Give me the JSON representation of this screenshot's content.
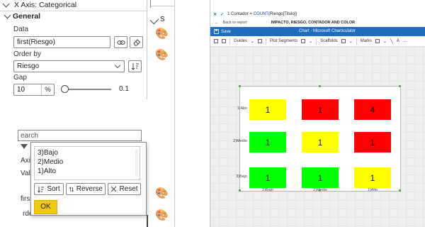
{
  "props": {
    "section_title": "X Axis: Categorical",
    "sub_title": "General",
    "data_label": "Data",
    "data_value": "first(Riesgo)",
    "order_label": "Order by",
    "order_value": "Riesgo",
    "gap_label": "Gap",
    "gap_value": "10",
    "gap_unit": "%",
    "gap_slider_value": "0.1"
  },
  "filter": {
    "search_placeholder": "earch",
    "frag_axis": "Axi",
    "frag_value": "Valu",
    "frag_first": "firs",
    "frag_order": "rde"
  },
  "sort_popup": {
    "items": [
      "3)Bajo",
      "2)Medio",
      "1)Alto"
    ],
    "sort_label": "Sort",
    "reverse_label": "Reverse",
    "reset_label": "Reset",
    "ok_label": "OK"
  },
  "window": {
    "fx_text": "1  Contador = COUNT(Riesgo[Titulo])",
    "fx_name": "Contador",
    "fx_fn": "COUNT",
    "fx_arg": "(Riesgo[Titulo])",
    "back_label": "Back to report",
    "report_title": "IMPACTO, RIESGO, CONTADOR AND COLOR",
    "title": "Chart - Microsoft Charticulator",
    "save_label": "Save",
    "toolbar": {
      "guides": "Guides",
      "plot_segments": "Plot Segments",
      "scaffolds": "Scaffolds",
      "marks": "Marks"
    }
  },
  "chart_data": {
    "type": "heatmap",
    "x_categories": [
      "3)Bajo",
      "2)Medio",
      "1)Alto"
    ],
    "y_categories": [
      "1)Alto",
      "2)Medio",
      "3)Bajo"
    ],
    "cells": [
      [
        {
          "value": 1,
          "color": "#ffff00"
        },
        {
          "value": 1,
          "color": "#ff0000"
        },
        {
          "value": 4,
          "color": "#ff0000"
        }
      ],
      [
        {
          "value": 1,
          "color": "#00ff00"
        },
        {
          "value": 1,
          "color": "#ffff00"
        },
        {
          "value": 1,
          "color": "#ff0000"
        }
      ],
      [
        {
          "value": 1,
          "color": "#00ff00"
        },
        {
          "value": 1,
          "color": "#00ff00"
        },
        {
          "value": 1,
          "color": "#ffff00"
        }
      ]
    ]
  },
  "colors": {
    "accent": "#1e6bc1",
    "ok_yellow": "#f2c811",
    "red": "#ff0000",
    "yellow": "#ffff00",
    "green": "#00ff00"
  }
}
